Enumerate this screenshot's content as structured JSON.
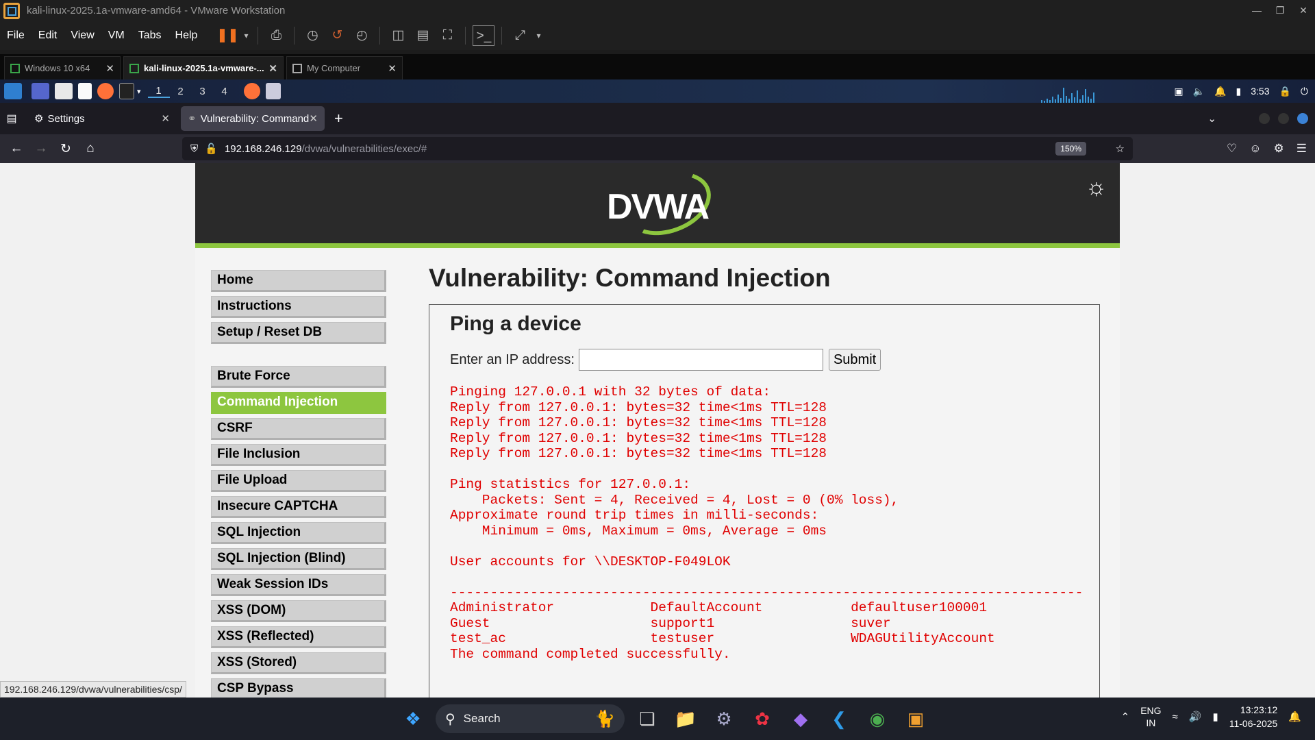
{
  "vmware": {
    "window_title": "kali-linux-2025.1a-vmware-amd64 - VMware Workstation",
    "menu": [
      "File",
      "Edit",
      "View",
      "VM",
      "Tabs",
      "Help"
    ],
    "tabs": [
      {
        "label": "Windows 10 x64"
      },
      {
        "label": "kali-linux-2025.1a-vmware-..."
      },
      {
        "label": "My Computer"
      }
    ]
  },
  "kali_panel": {
    "workspaces": [
      "1",
      "2",
      "3",
      "4"
    ],
    "clock": "3:53"
  },
  "firefox": {
    "tabs": [
      {
        "label": "Settings"
      },
      {
        "label": "Vulnerability: Command I"
      }
    ],
    "url_host": "192.168.246.129",
    "url_path": "/dvwa/vulnerabilities/exec/#",
    "zoom": "150%"
  },
  "dvwa": {
    "logo_text": "DVWA",
    "nav_top": [
      "Home",
      "Instructions",
      "Setup / Reset DB"
    ],
    "nav_vulns": [
      "Brute Force",
      "Command Injection",
      "CSRF",
      "File Inclusion",
      "File Upload",
      "Insecure CAPTCHA",
      "SQL Injection",
      "SQL Injection (Blind)",
      "Weak Session IDs",
      "XSS (DOM)",
      "XSS (Reflected)",
      "XSS (Stored)",
      "CSP Bypass"
    ],
    "active_nav": "Command Injection",
    "page_title": "Vulnerability: Command Injection",
    "box_title": "Ping a device",
    "ip_label": "Enter an IP address:",
    "ip_value": "",
    "submit_label": "Submit",
    "output": "Pinging 127.0.0.1 with 32 bytes of data:\nReply from 127.0.0.1: bytes=32 time<1ms TTL=128\nReply from 127.0.0.1: bytes=32 time<1ms TTL=128\nReply from 127.0.0.1: bytes=32 time<1ms TTL=128\nReply from 127.0.0.1: bytes=32 time<1ms TTL=128\n\nPing statistics for 127.0.0.1:\n    Packets: Sent = 4, Received = 4, Lost = 0 (0% loss),\nApproximate round trip times in milli-seconds:\n    Minimum = 0ms, Maximum = 0ms, Average = 0ms\n\nUser accounts for \\\\DESKTOP-F049LOK\n\n-------------------------------------------------------------------------------\nAdministrator            DefaultAccount           defaultuser100001\nGuest                    support1                 suver\ntest_ac                  testuser                 WDAGUtilityAccount\nThe command completed successfully."
  },
  "status_bar_url": "192.168.246.129/dvwa/vulnerabilities/csp/",
  "windows_taskbar": {
    "search_placeholder": "Search",
    "lang_top": "ENG",
    "lang_bottom": "IN",
    "time": "13:23:12",
    "date": "11-06-2025"
  },
  "colors": {
    "dvwa_green": "#8dc63f",
    "output_red": "#e00000"
  }
}
